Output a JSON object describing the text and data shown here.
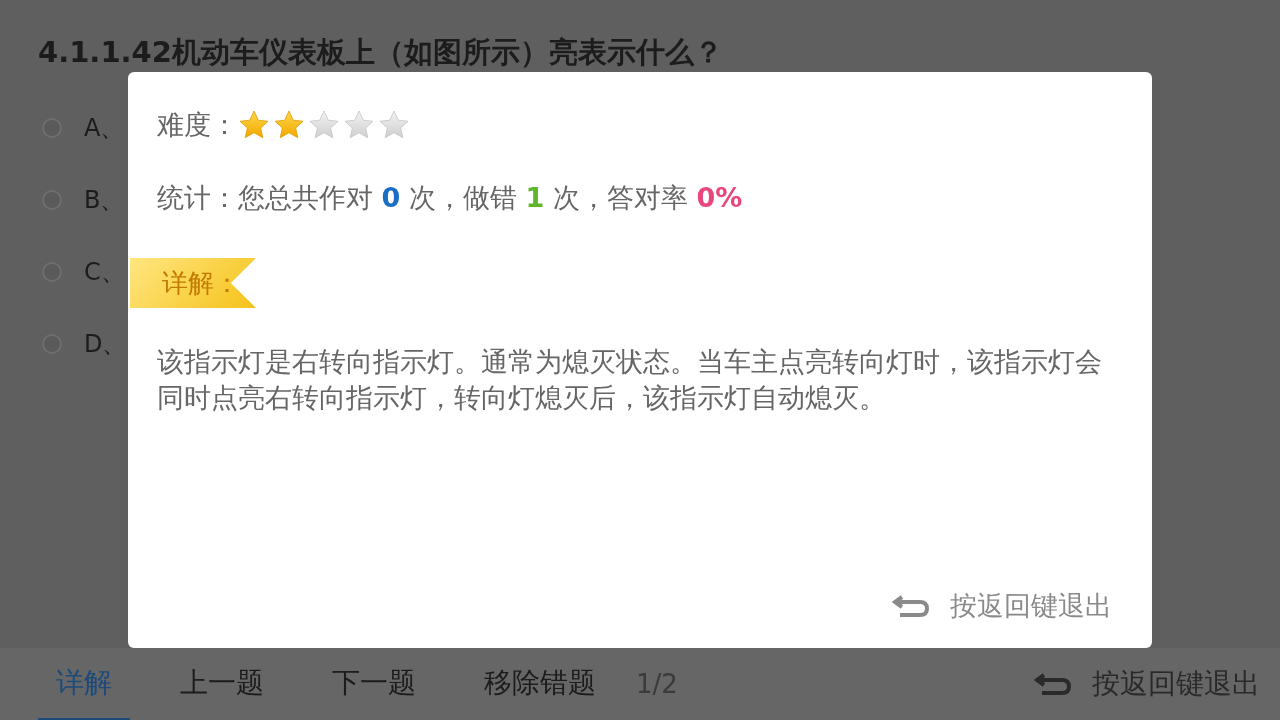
{
  "question": {
    "title": "4.1.1.42机动车仪表板上（如图所示）亮表示什么？",
    "options": [
      {
        "label": "A、",
        "selected": false
      },
      {
        "label": "B、",
        "selected": false
      },
      {
        "label": "C、",
        "selected": false
      },
      {
        "label": "D、",
        "selected": false
      }
    ]
  },
  "dialog": {
    "difficulty_label": "难度：",
    "stars": 2,
    "stats": [
      {
        "text": "统计：您总共作对 ",
        "kind": "plain"
      },
      {
        "text": "0",
        "kind": "correct"
      },
      {
        "text": " 次，做错 ",
        "kind": "plain"
      },
      {
        "text": "1",
        "kind": "wrong"
      },
      {
        "text": " 次，答对率 ",
        "kind": "plain"
      },
      {
        "text": "0%",
        "kind": "rate"
      }
    ],
    "ribbon": "详解：",
    "explanation": "该指示灯是右转向指示灯。通常为熄灭状态。当车主点亮转向灯时，该指示灯会同时点亮右转向指示灯，转向灯熄灭后，该指示灯自动熄灭。",
    "back_hint": "按返回键退出"
  },
  "bottom_bar": {
    "tabs": [
      {
        "label": "详解",
        "selected": true
      },
      {
        "label": "上一题",
        "selected": false
      },
      {
        "label": "下一题",
        "selected": false
      },
      {
        "label": "移除错题",
        "selected": false
      }
    ],
    "page": "1/2",
    "back_hint": "按返回键退出"
  }
}
